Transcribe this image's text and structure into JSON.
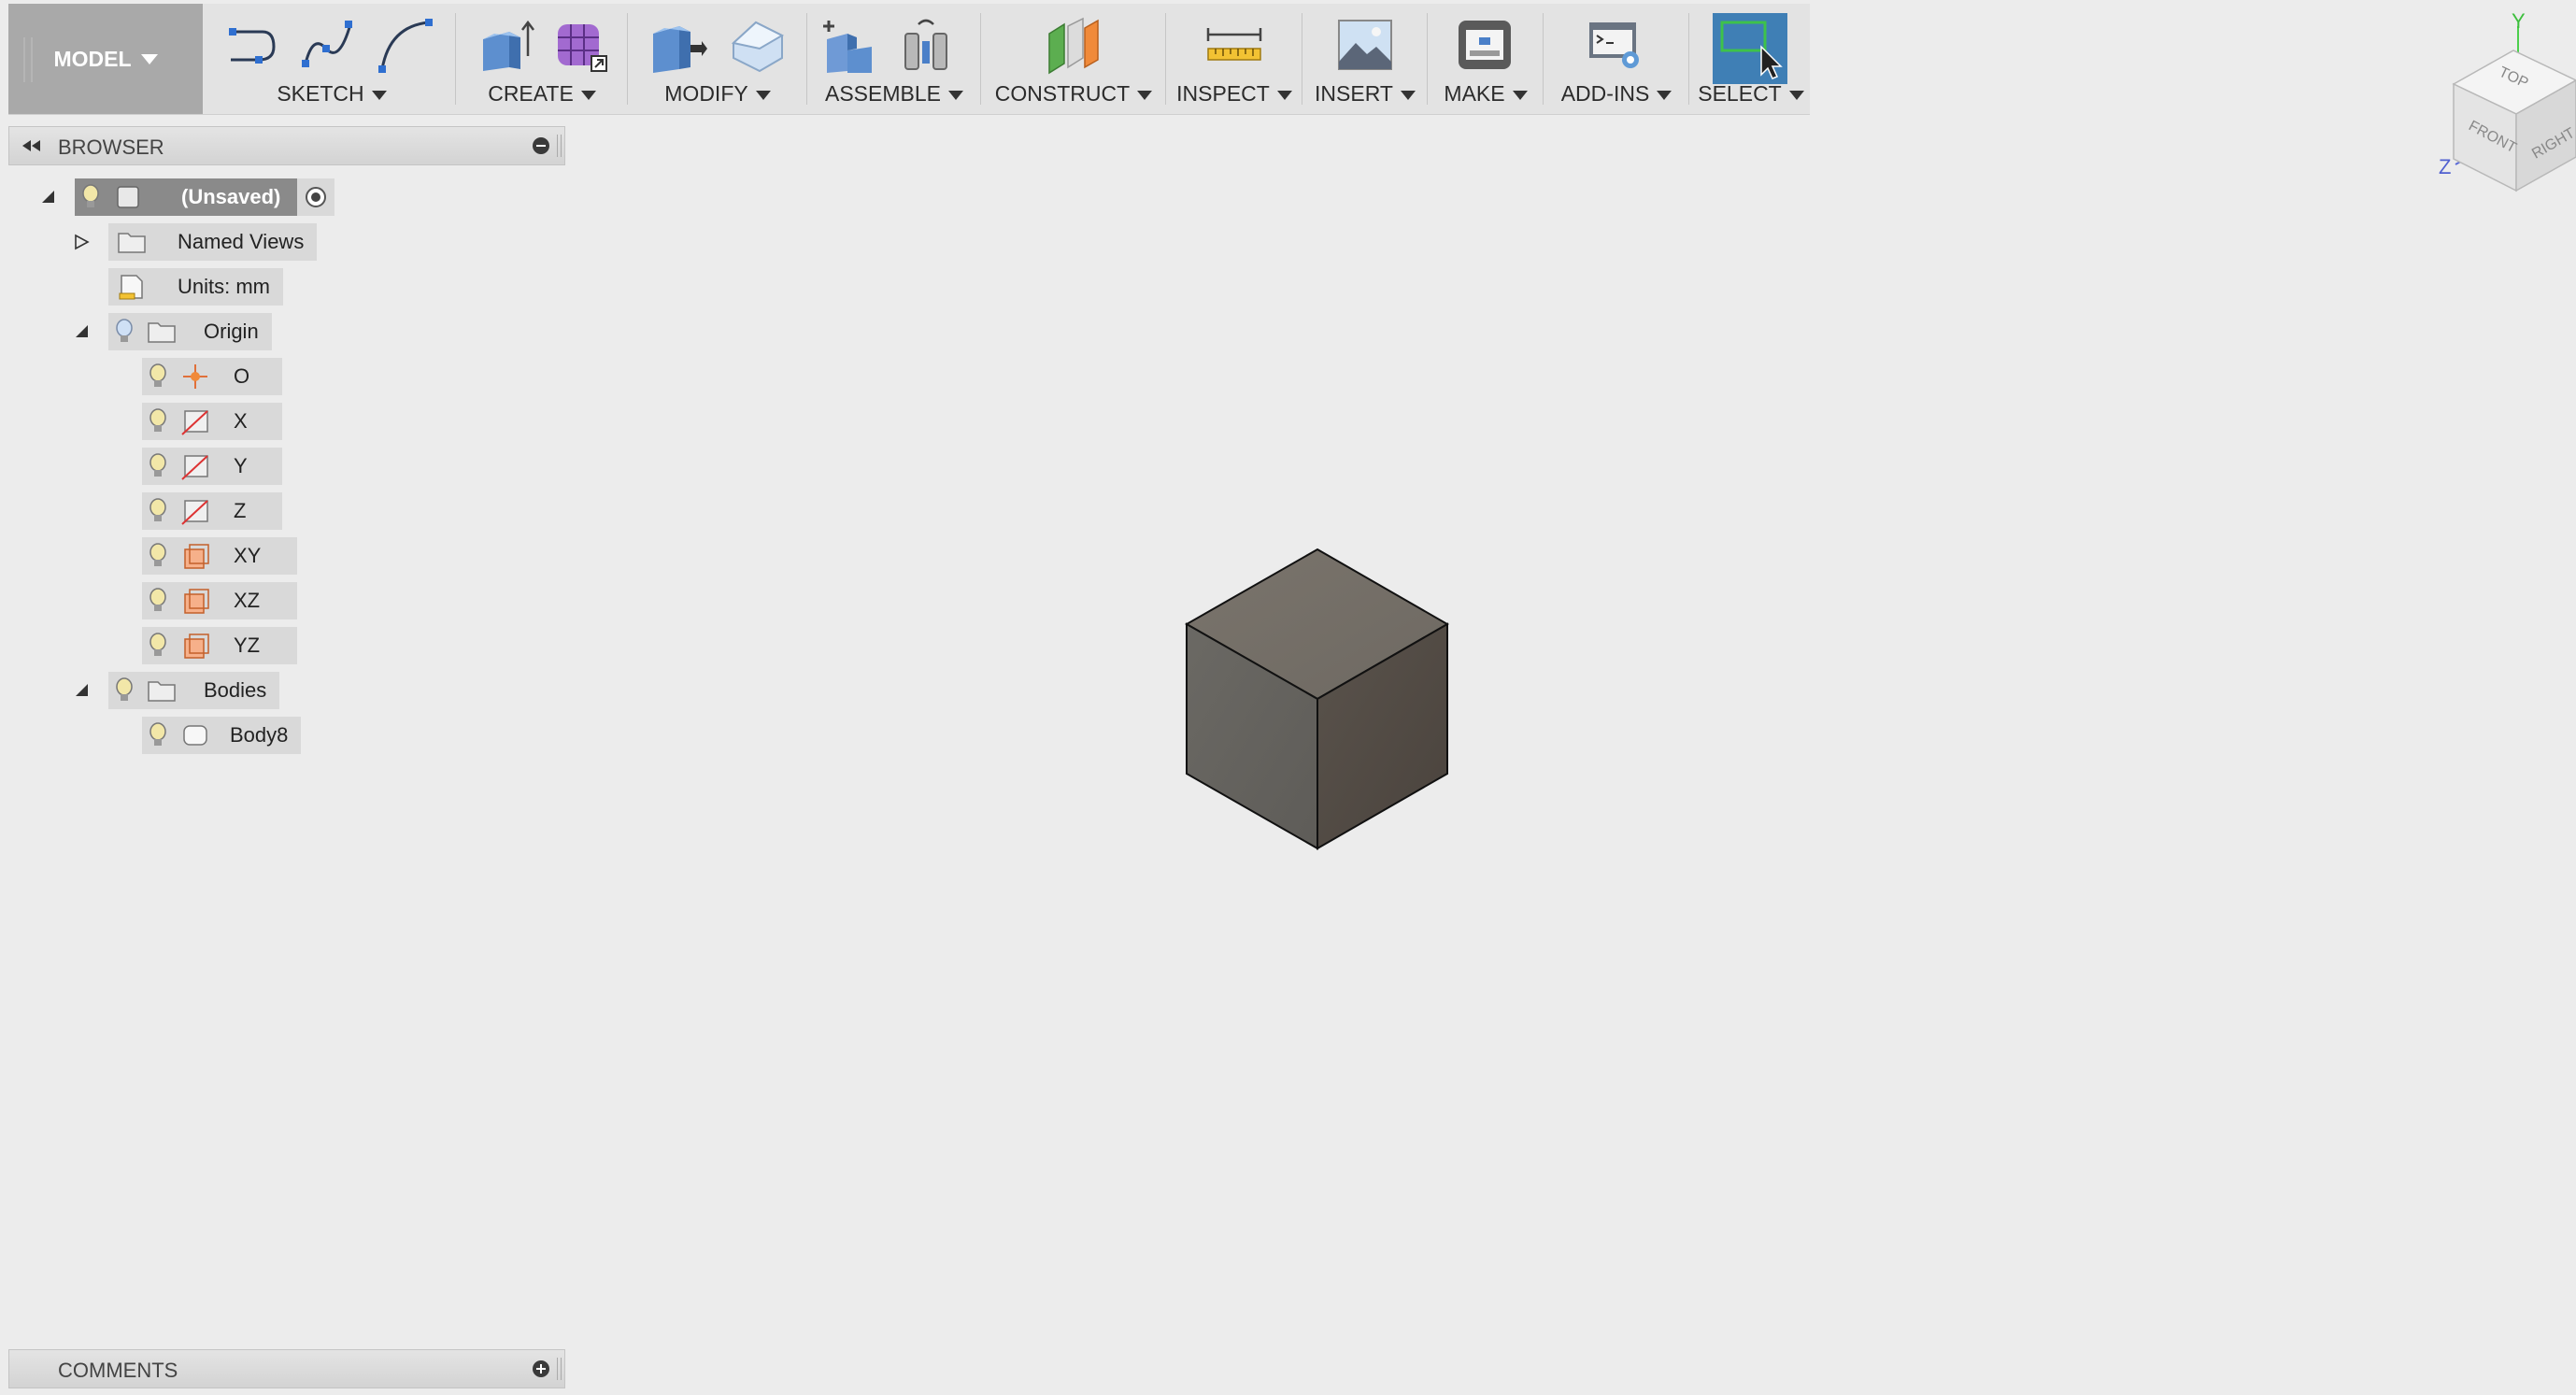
{
  "toolbar": {
    "workspace": "MODEL",
    "groups": {
      "sketch": "SKETCH",
      "create": "CREATE",
      "modify": "MODIFY",
      "assemble": "ASSEMBLE",
      "construct": "CONSTRUCT",
      "inspect": "INSPECT",
      "insert": "INSERT",
      "make": "MAKE",
      "addins": "ADD-INS",
      "select": "SELECT"
    }
  },
  "browser": {
    "title": "BROWSER",
    "root": "(Unsaved)",
    "named_views": "Named Views",
    "units": "Units: mm",
    "origin": {
      "label": "Origin",
      "items": [
        "O",
        "X",
        "Y",
        "Z",
        "XY",
        "XZ",
        "YZ"
      ]
    },
    "bodies": {
      "label": "Bodies",
      "items": [
        "Body8"
      ]
    }
  },
  "comments": {
    "title": "COMMENTS"
  },
  "viewcube": {
    "top": "TOP",
    "front": "FRONT",
    "right": "RIGHT",
    "axis_y": "Y",
    "axis_z": "Z"
  },
  "colors": {
    "select_active": "#3f7fb5",
    "selected_node": "#8a8a8a",
    "cube_top": "#76716a",
    "cube_left": "#66645f",
    "cube_right": "#514a44"
  }
}
